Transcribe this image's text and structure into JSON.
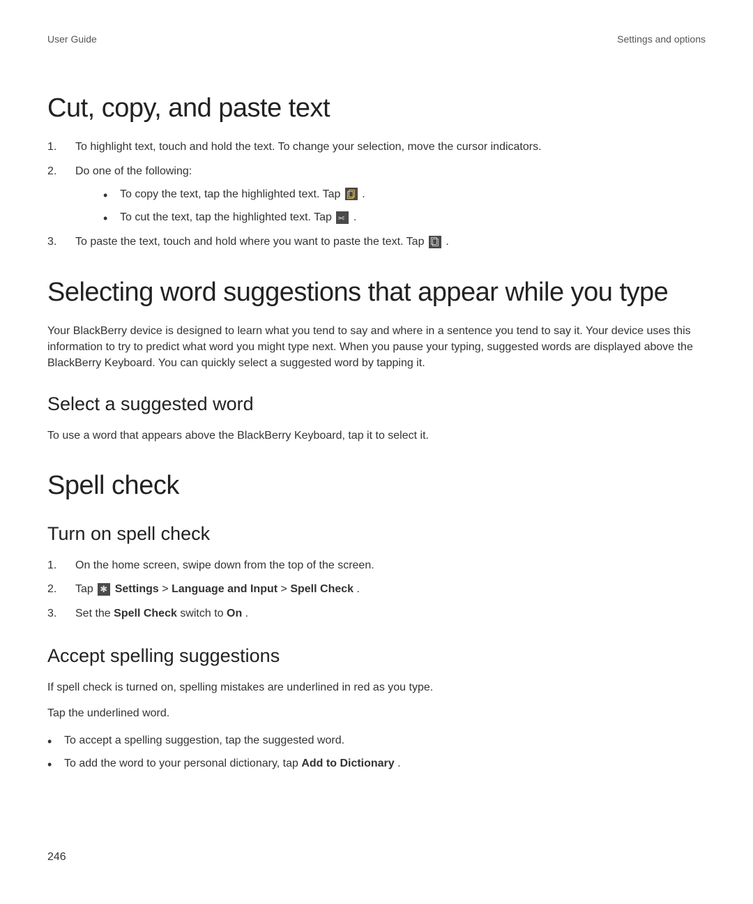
{
  "header": {
    "left": "User Guide",
    "right": "Settings and options"
  },
  "section1": {
    "title": "Cut, copy, and paste text",
    "step1": "To highlight text, touch and hold the text. To change your selection, move the cursor indicators.",
    "step2": "Do one of the following:",
    "bullet_copy_pre": "To copy the text, tap the highlighted text. Tap ",
    "bullet_copy_post": " .",
    "bullet_cut_pre": "To cut the text, tap the highlighted text. Tap ",
    "bullet_cut_post": " .",
    "step3_pre": "To paste the text, touch and hold where you want to paste the text. Tap ",
    "step3_post": " ."
  },
  "section2": {
    "title": "Selecting word suggestions that appear while you type",
    "para": "Your BlackBerry device is designed to learn what you tend to say and where in a sentence you tend to say it. Your device uses this information to try to predict what word you might type next. When you pause your typing, suggested words are displayed above the BlackBerry Keyboard. You can quickly select a suggested word by tapping it.",
    "sub_title": "Select a suggested word",
    "sub_para": "To use a word that appears above the BlackBerry Keyboard, tap it to select it."
  },
  "section3": {
    "title": "Spell check",
    "sub1_title": "Turn on spell check",
    "s1_step1": "On the home screen, swipe down from the top of the screen.",
    "s1_step2_pre": "Tap ",
    "s1_step2_b1": "Settings",
    "s1_step2_sep1": " > ",
    "s1_step2_b2": "Language and Input",
    "s1_step2_sep2": " > ",
    "s1_step2_b3": "Spell Check",
    "s1_step2_post": ".",
    "s1_step3_pre": "Set the ",
    "s1_step3_b1": "Spell Check",
    "s1_step3_mid": " switch to ",
    "s1_step3_b2": "On",
    "s1_step3_post": ".",
    "sub2_title": "Accept spelling suggestions",
    "sub2_para1": "If spell check is turned on, spelling mistakes are underlined in red as you type.",
    "sub2_para2": "Tap the underlined word.",
    "sub2_bul1": "To accept a spelling suggestion, tap the suggested word.",
    "sub2_bul2_pre": "To add the word to your personal dictionary, tap ",
    "sub2_bul2_b": "Add to Dictionary",
    "sub2_bul2_post": "."
  },
  "page_number": "246"
}
